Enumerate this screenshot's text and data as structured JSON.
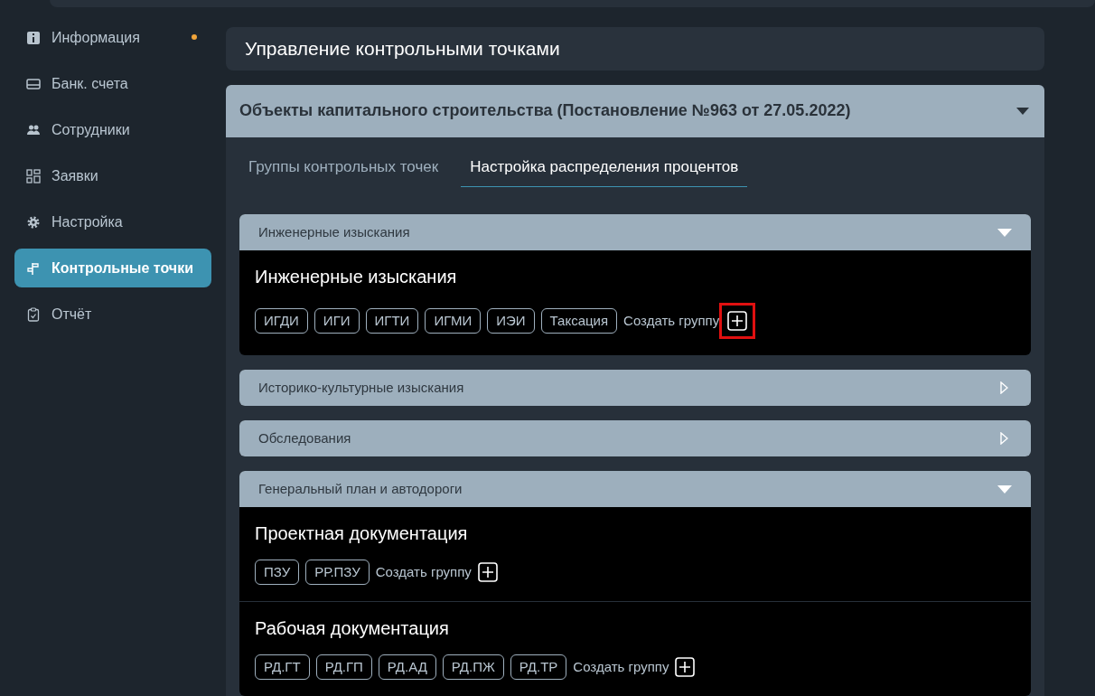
{
  "sidebar": {
    "items": [
      {
        "label": "Информация",
        "kind": "info",
        "selected": false,
        "notice": true
      },
      {
        "label": "Банк. счета",
        "kind": "card",
        "selected": false,
        "notice": false
      },
      {
        "label": "Сотрудники",
        "kind": "people",
        "selected": false,
        "notice": false
      },
      {
        "label": "Заявки",
        "kind": "grid",
        "selected": false,
        "notice": false
      },
      {
        "label": "Настройка",
        "kind": "gear",
        "selected": false,
        "notice": false
      },
      {
        "label": "Контрольные точки",
        "kind": "signpost",
        "selected": true,
        "notice": false
      },
      {
        "label": "Отчёт",
        "kind": "clipboard",
        "selected": false,
        "notice": false
      }
    ]
  },
  "page_title": "Управление контрольными точками",
  "section": {
    "title": "Объекты капитального строительства (Постановление №963 от 27.05.2022)",
    "expanded": true,
    "tabs": [
      {
        "label": "Группы контрольных точек",
        "selected": false
      },
      {
        "label": "Настройка распределения процентов",
        "selected": true
      }
    ],
    "accordions": [
      {
        "title": "Инженерные изыскания",
        "expanded": true,
        "groups": [
          {
            "title": "Инженерные изыскания",
            "tags": [
              "ИГДИ",
              "ИГИ",
              "ИГТИ",
              "ИГМИ",
              "ИЭИ",
              "Таксация"
            ],
            "create_label": "Создать группу",
            "highlighted": true
          }
        ]
      },
      {
        "title": "Историко-культурные изыскания",
        "expanded": false
      },
      {
        "title": "Обследования",
        "expanded": false
      },
      {
        "title": "Генеральный план и автодороги",
        "expanded": true,
        "groups": [
          {
            "title": "Проектная документация",
            "tags": [
              "ПЗУ",
              "РР.ПЗУ"
            ],
            "create_label": "Создать группу",
            "highlighted": false
          },
          {
            "title": "Рабочая документация",
            "tags": [
              "РД.ГТ",
              "РД.ГП",
              "РД.АД",
              "РД.ПЖ",
              "РД.ТР"
            ],
            "create_label": "Создать группу",
            "highlighted": false
          }
        ]
      }
    ]
  }
}
